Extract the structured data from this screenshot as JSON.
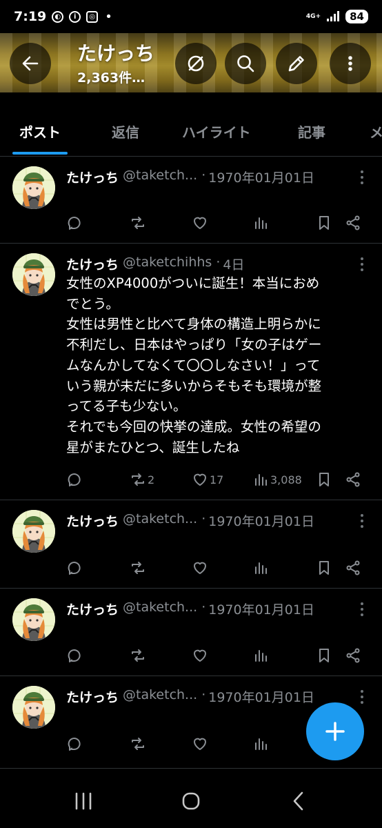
{
  "status_bar": {
    "time": "7:19",
    "network": "4G+",
    "battery": "84"
  },
  "header": {
    "name": "たけっち",
    "post_count": "2,363件…"
  },
  "tabs": [
    {
      "label": "ポスト",
      "active": true
    },
    {
      "label": "返信",
      "active": false
    },
    {
      "label": "ハイライト",
      "active": false
    },
    {
      "label": "記事",
      "active": false
    },
    {
      "label": "メ",
      "active": false
    }
  ],
  "posts": [
    {
      "name": "たけっち",
      "handle": "@taketch...",
      "sep": "·",
      "date": "1970年01月01日"
    },
    {
      "name": "たけっち",
      "handle": "@taketchihhs",
      "sep": "·",
      "date": "4日",
      "lines": [
        "女性のXP4000がついに誕生！本当におめ",
        "でとう。",
        "女性は男性と比べて身体の構造上明らかに",
        "不利だし、日本はやっぱり「女の子はゲー",
        "ムなんかしてなくて〇〇しなさい！」って",
        "いう親が未だに多いからそもそも環境が整",
        "ってる子も少ない。",
        "それでも今回の快挙の達成。女性の希望の",
        "星がまたひとつ、誕生したね"
      ],
      "retweets": "2",
      "likes": "17",
      "views": "3,088"
    },
    {
      "name": "たけっち",
      "handle": "@taketch...",
      "sep": "·",
      "date": "1970年01月01日"
    },
    {
      "name": "たけっち",
      "handle": "@taketch...",
      "sep": "·",
      "date": "1970年01月01日"
    },
    {
      "name": "たけっち",
      "handle": "@taketch...",
      "sep": "·",
      "date": "1970年01月01日"
    }
  ],
  "colors": {
    "accent": "#1d9bf0",
    "muted": "#8b8f94",
    "background": "#000000",
    "divider": "#2f3336"
  }
}
